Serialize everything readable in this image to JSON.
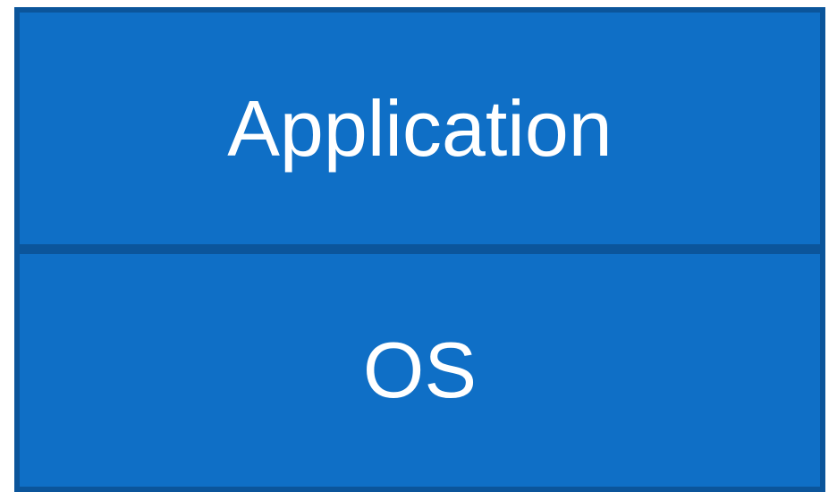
{
  "diagram": {
    "layers": [
      {
        "label": "Application"
      },
      {
        "label": "OS"
      }
    ],
    "colors": {
      "fill": "#0f6fc6",
      "border": "#0b559b",
      "text": "#ffffff"
    }
  }
}
